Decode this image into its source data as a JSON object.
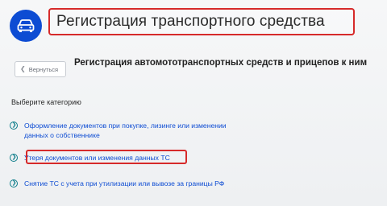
{
  "header": {
    "title": "Регистрация транспортного средства",
    "icon": "car-icon"
  },
  "nav": {
    "back_label": "Вернуться",
    "back_icon": "chevron-left-icon"
  },
  "main": {
    "subtitle": "Регистрация автомототранспортных средств и прицепов к ним",
    "category_prompt": "Выберите категорию",
    "items": [
      {
        "line1": "Оформление документов при покупке, лизинге или изменении",
        "line2": "данных о собственнике",
        "icon": "chevron-circle-icon"
      },
      {
        "line1": "Утеря документов или изменения данных ТС",
        "icon": "chevron-circle-icon",
        "highlighted": true
      },
      {
        "line1": "Снятие ТС с учета при утилизации или вывозе за границы РФ",
        "icon": "chevron-circle-icon"
      }
    ]
  },
  "colors": {
    "brand_blue": "#0d4cd3",
    "highlight_red": "#d62a2a",
    "icon_teal": "#0d7d8a"
  }
}
